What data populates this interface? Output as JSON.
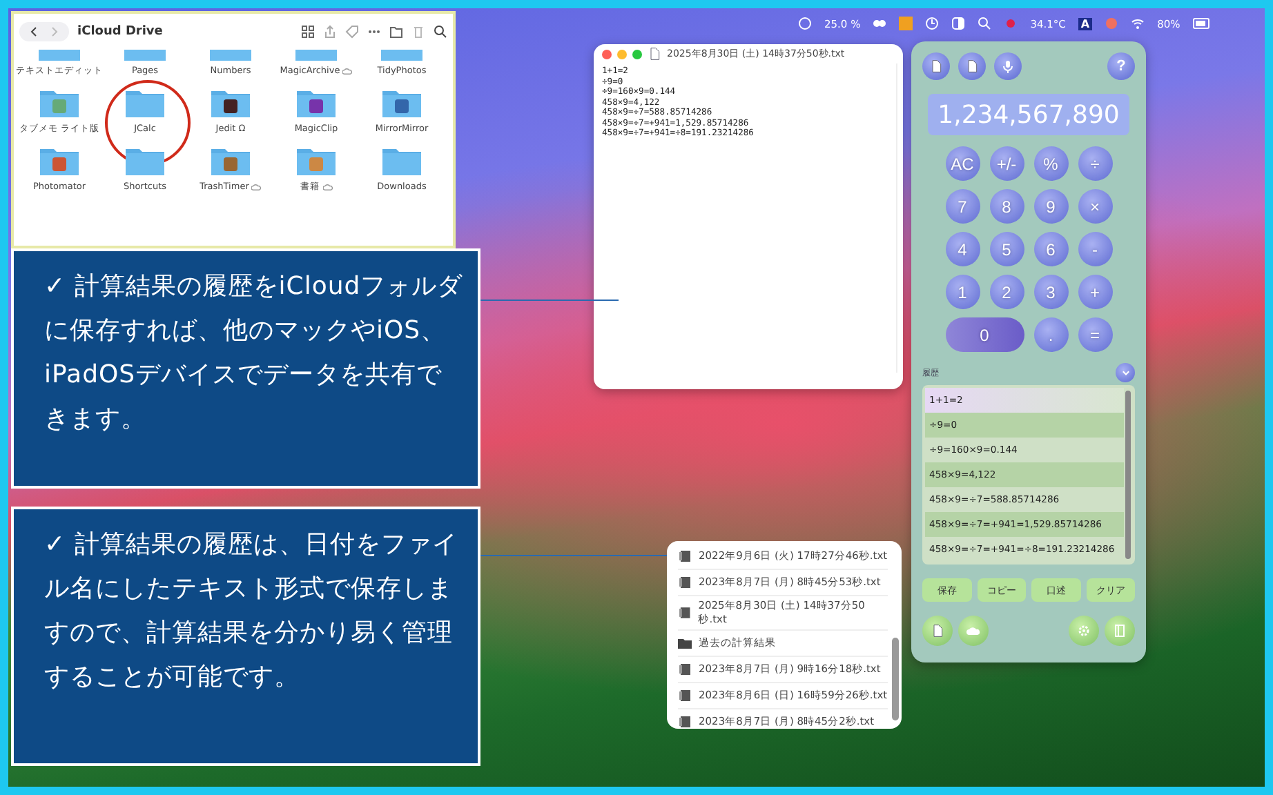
{
  "finder": {
    "title": "iCloud Drive",
    "items": [
      {
        "label": "テキストエディット",
        "cloud": false,
        "circled": false
      },
      {
        "label": "Pages",
        "cloud": false,
        "circled": false
      },
      {
        "label": "Numbers",
        "cloud": false,
        "circled": false
      },
      {
        "label": "MagicArchive",
        "cloud": true,
        "circled": false
      },
      {
        "label": "TidyPhotos",
        "cloud": false,
        "circled": false
      },
      {
        "label": "タブメモ ライト版",
        "cloud": false,
        "circled": false
      },
      {
        "label": "JCalc",
        "cloud": false,
        "circled": true
      },
      {
        "label": "Jedit Ω",
        "cloud": false,
        "circled": false
      },
      {
        "label": "MagicClip",
        "cloud": false,
        "circled": false
      },
      {
        "label": "MirrorMirror",
        "cloud": false,
        "circled": false
      },
      {
        "label": "Photomator",
        "cloud": false,
        "circled": false
      },
      {
        "label": "Shortcuts",
        "cloud": false,
        "circled": false
      },
      {
        "label": "TrashTimer",
        "cloud": true,
        "circled": false
      },
      {
        "label": "書籍",
        "cloud": true,
        "circled": false
      },
      {
        "label": "Downloads",
        "cloud": false,
        "circled": false
      }
    ]
  },
  "menu_bar": {
    "cpu": "25.0 %",
    "input_letter": "A",
    "temperature": "34.1°C",
    "battery": "80%"
  },
  "editor": {
    "title": "2025年8月30日 (土) 14時37分50秒.txt",
    "lines": [
      "1+1=2",
      "÷9=0",
      "÷9=160×9=0.144",
      "458×9=4,122",
      "458×9=÷7=588.85714286",
      "458×9=÷7=+941=1,529.85714286",
      "458×9=÷7=+941=÷8=191.23214286"
    ]
  },
  "calculator": {
    "display": "1,234,567,890",
    "help": "?",
    "keys": [
      {
        "label": "AC",
        "kind": "round"
      },
      {
        "label": "+/-",
        "kind": "round"
      },
      {
        "label": "%",
        "kind": "round"
      },
      {
        "label": "÷",
        "kind": "round"
      },
      {
        "label": "7",
        "kind": "round"
      },
      {
        "label": "8",
        "kind": "round"
      },
      {
        "label": "9",
        "kind": "round"
      },
      {
        "label": "×",
        "kind": "round"
      },
      {
        "label": "4",
        "kind": "round"
      },
      {
        "label": "5",
        "kind": "round"
      },
      {
        "label": "6",
        "kind": "round"
      },
      {
        "label": "-",
        "kind": "round"
      },
      {
        "label": "1",
        "kind": "round"
      },
      {
        "label": "2",
        "kind": "round"
      },
      {
        "label": "3",
        "kind": "round"
      },
      {
        "label": "+",
        "kind": "round"
      },
      {
        "label": "0",
        "kind": "wide"
      },
      {
        "label": ".",
        "kind": "round"
      },
      {
        "label": "=",
        "kind": "round"
      }
    ],
    "history_label": "履歴",
    "history": [
      "1+1=2",
      "÷9=0",
      "÷9=160×9=0.144",
      "458×9=4,122",
      "458×9=÷7=588.85714286",
      "458×9=÷7=+941=1,529.85714286",
      "458×9=÷7=+941=÷8=191.23214286"
    ],
    "actions": [
      "保存",
      "コピー",
      "口述",
      "クリア"
    ]
  },
  "file_popup": {
    "items": [
      {
        "label": "2022年9月6日 (火) 17時27分46秒.txt",
        "kind": "file"
      },
      {
        "label": "2023年8月7日 (月) 8時45分53秒.txt",
        "kind": "file"
      },
      {
        "label": "2025年8月30日 (土) 14時37分50秒.txt",
        "kind": "file"
      },
      {
        "label": "過去の計算結果",
        "kind": "folder"
      },
      {
        "label": "2023年8月7日 (月) 9時16分18秒.txt",
        "kind": "file"
      },
      {
        "label": "2023年8月6日 (日) 16時59分26秒.txt",
        "kind": "file"
      },
      {
        "label": "2023年8月7日 (月) 8時45分2秒.txt",
        "kind": "file"
      }
    ]
  },
  "callouts": [
    "✓ 計算結果の履歴をiCloudフォルダに保存すれば、他のマックやiOS、iPadOSデバイスでデータを共有できます。",
    "✓ 計算結果の履歴は、日付をファイル名にしたテキスト形式で保存しますので、計算結果を分かり易く管理することが可能です。"
  ]
}
